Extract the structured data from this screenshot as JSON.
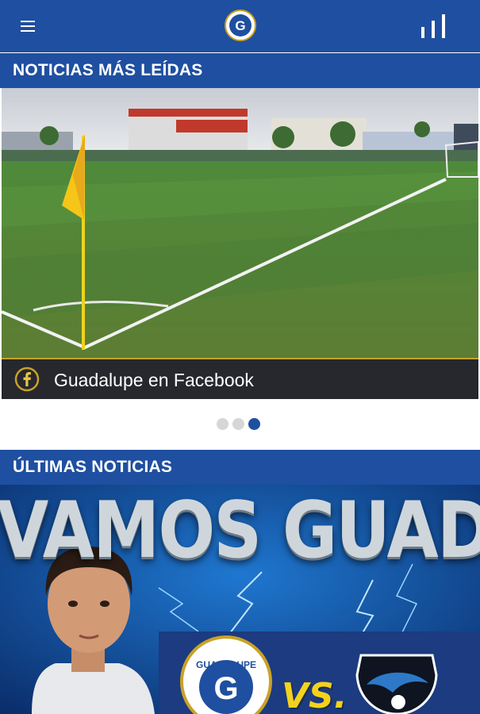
{
  "app": {
    "menu_icon": "hamburger-menu-icon",
    "logo_letter": "G",
    "stats_icon": "bar-chart-icon",
    "brand_color": "#1f4fa0",
    "accent_color": "#c9a227"
  },
  "sections": {
    "top_title": "NOTICIAS MÁS LEÍDAS",
    "latest_title": "ÚLTIMAS NOTICIAS"
  },
  "carousel": {
    "caption": "Guadalupe en Facebook",
    "caption_icon": "facebook-icon",
    "slide_count": 3,
    "active_index": 2
  },
  "latest": {
    "headline": "VAMOS GUADA",
    "home_team": "GUADALUPE",
    "vs_label": "VS.",
    "away_team_crest": "Municipal Grecia"
  }
}
